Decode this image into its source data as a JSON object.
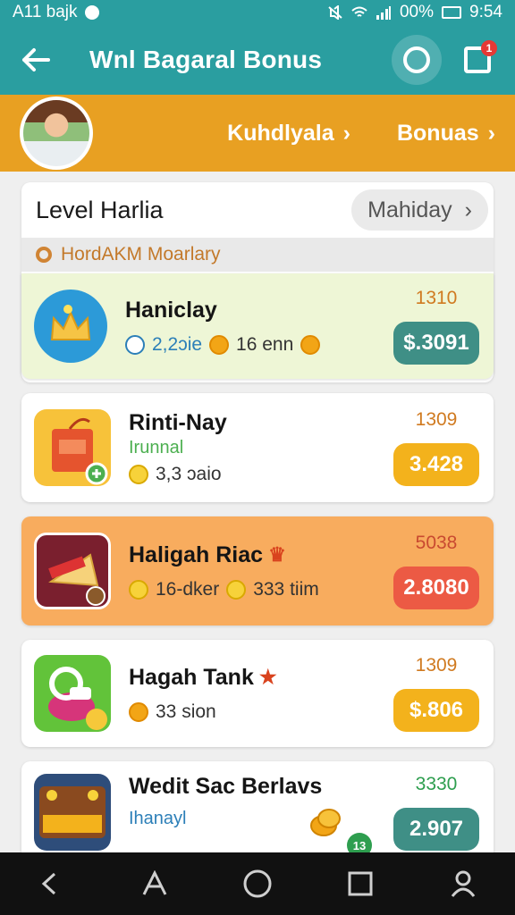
{
  "status": {
    "left_text": "A11 bajk",
    "battery_pct": "00%",
    "time": "9:54"
  },
  "appbar": {
    "title": "Wnl Bagaral Bonus"
  },
  "profile": {
    "link1": "Kuhdlyala",
    "link2": "Bonuas"
  },
  "panel": {
    "title": "Level Harlia",
    "pill": "Mahiday",
    "subtitle": "HordAKM Moarlary"
  },
  "cards": [
    {
      "name": "Haniclay",
      "tag": "",
      "meta1": "2,2ɔie",
      "meta2": "16 enn",
      "score": "1310",
      "price": "$.3091",
      "price_color": "#3f8f86",
      "score_color": "#d07a20",
      "bg": "#eef6d6"
    },
    {
      "name": "Rinti-Nay",
      "tag": "Irunnal",
      "meta1": "3,3 ɔaio",
      "meta2": "",
      "score": "1309",
      "price": "3.428",
      "price_color": "#f3b21c",
      "score_color": "#d07a20",
      "bg": "#ffffff"
    },
    {
      "name": "Haligah Riac",
      "tag": "",
      "meta1": "16-dker",
      "meta2": "333 tiim",
      "score": "5038",
      "price": "2.8080",
      "price_color": "#ec5a44",
      "score_color": "#c94a30",
      "bg": "#f8ac5e"
    },
    {
      "name": "Hagah Tank",
      "tag": "",
      "meta1": "33 sion",
      "meta2": "",
      "score": "1309",
      "price": "$.806",
      "price_color": "#f3b21c",
      "score_color": "#d07a20",
      "bg": "#ffffff"
    },
    {
      "name": "Wedit Sac Berlavs",
      "tag": "Ihanayl",
      "meta1": "",
      "meta2": "",
      "score": "3330",
      "price": "2.907",
      "price_color": "#3f8f86",
      "score_color": "#2e9e4f",
      "bg": "#ffffff"
    }
  ],
  "icons": {
    "back": "arrow-left-icon",
    "chat": "chat-bubble-icon",
    "edit": "edit-note-icon",
    "nav": [
      "back-triangle-icon",
      "home-a-icon",
      "home-circle-icon",
      "recents-square-icon",
      "profile-icon"
    ]
  },
  "colors": {
    "teal": "#2a9ea0",
    "orange_bar": "#e8a022"
  },
  "edit_badge": "1",
  "card5_badge": "13"
}
